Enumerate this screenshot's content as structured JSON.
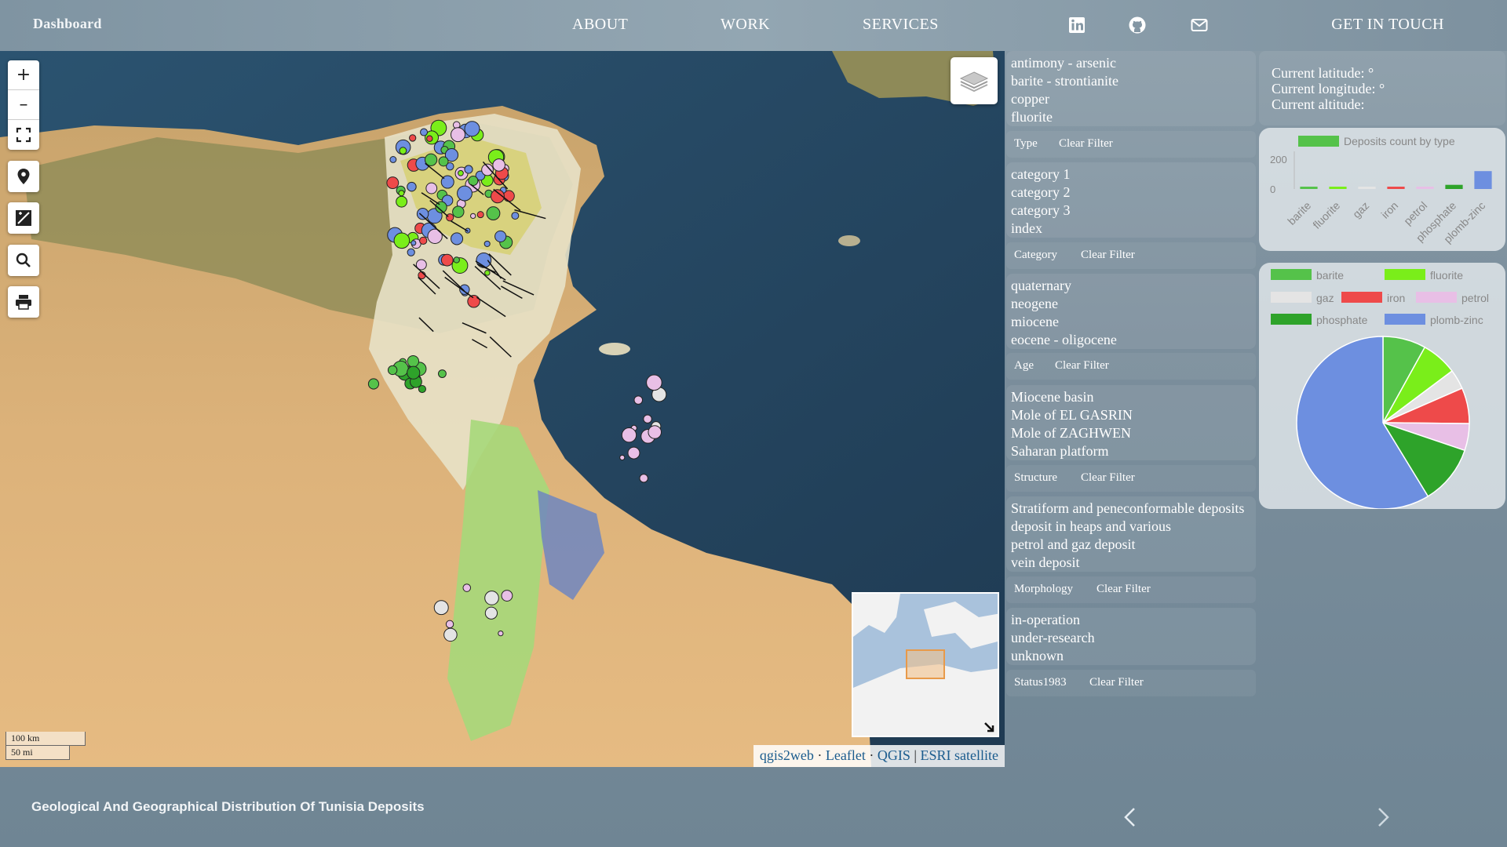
{
  "header": {
    "brand": "Dashboard",
    "nav": [
      "ABOUT",
      "WORK",
      "SERVICES"
    ],
    "icons": [
      "linkedin-icon",
      "github-icon",
      "mail-icon"
    ],
    "cta": "GET IN TOUCH"
  },
  "map": {
    "scale": [
      "100 km",
      "50 mi"
    ],
    "attribution": {
      "qgis2web": "qgis2web",
      "leaflet": "Leaflet",
      "qgis": "QGIS",
      "esri": "ESRI satellite"
    },
    "zoom_in": "+",
    "zoom_out": "–"
  },
  "filters": {
    "type": {
      "items": [
        "antimony - arsenic",
        "barite - strontianite",
        "copper",
        "fluorite"
      ],
      "label": "Type"
    },
    "category": {
      "items": [
        "category 1",
        "category 2",
        "category 3",
        "index"
      ],
      "label": "Category"
    },
    "age": {
      "items": [
        "quaternary",
        "neogene",
        "miocene",
        "eocene - oligocene"
      ],
      "label": "Age"
    },
    "structure": {
      "items": [
        "Miocene basin",
        "Mole of EL GASRIN",
        "Mole of ZAGHWEN",
        "Saharan platform"
      ],
      "label": "Structure"
    },
    "morphology": {
      "items": [
        "Stratiform and peneconformable deposits",
        "deposit in heaps and various",
        "petrol and gaz deposit",
        "vein deposit"
      ],
      "label": "Morphology"
    },
    "status": {
      "items": [
        "in-operation",
        "under-research",
        "unknown"
      ],
      "label": "Status1983"
    },
    "clear_label": "Clear Filter"
  },
  "coords": {
    "lat": "Current latitude: °",
    "lon": "Current longitude: °",
    "alt": "Current altitude:"
  },
  "colors": {
    "barite": "#55c24a",
    "fluorite": "#7aee1a",
    "gaz": "#e4e4e4",
    "iron": "#ee4a4a",
    "petrol": "#e8bfe6",
    "phosphate": "#2ea32a",
    "plomb_zinc": "#6d8fe0"
  },
  "chart_data": [
    {
      "type": "bar",
      "title": "",
      "legend": [
        "Deposits count by type"
      ],
      "categories": [
        "barite",
        "fluorite",
        "gaz",
        "iron",
        "petrol",
        "phosphate",
        "plomb-zinc"
      ],
      "series": [
        {
          "name": "Deposits count by type",
          "values": [
            8,
            10,
            3,
            12,
            4,
            28,
            120
          ]
        }
      ],
      "yticks": [
        "200",
        "0"
      ],
      "ylim": [
        0,
        200
      ]
    },
    {
      "type": "pie",
      "categories": [
        "barite",
        "fluorite",
        "gaz",
        "iron",
        "petrol",
        "phosphate",
        "plomb-zinc"
      ],
      "values": [
        24,
        20,
        11,
        20,
        15,
        33,
        175
      ]
    }
  ],
  "footer": {
    "title": "Geological And Geographical Distribution Of Tunisia Deposits"
  }
}
